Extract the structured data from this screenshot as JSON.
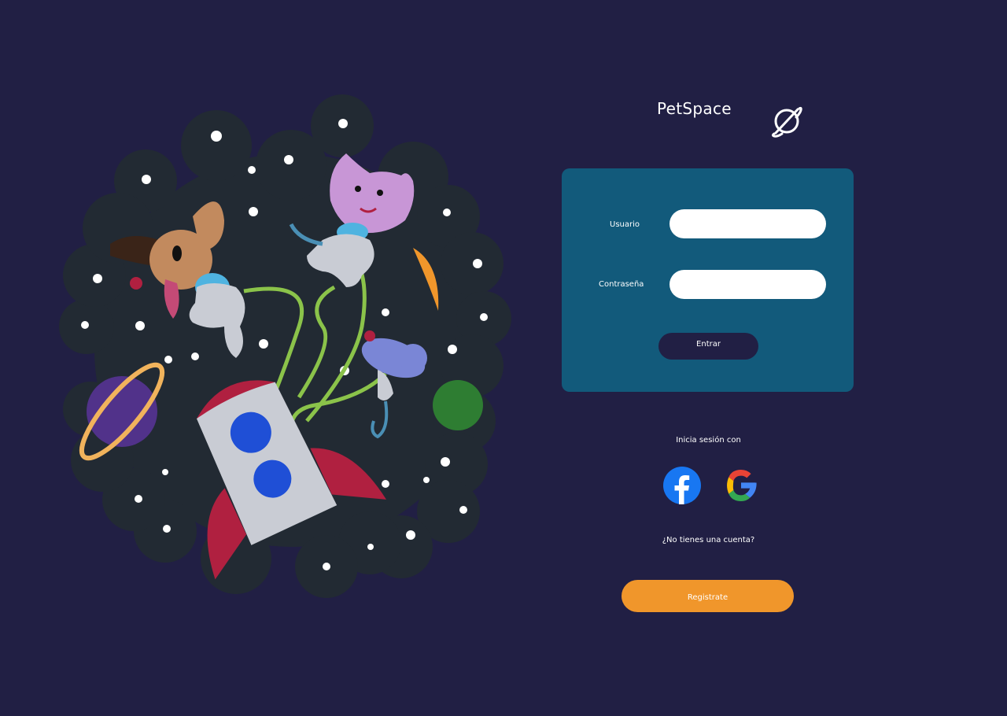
{
  "brand": {
    "name": "PetSpace",
    "logo_icon": "planet-icon"
  },
  "illustration": {
    "description_icon": "space-pets-illustration-icon"
  },
  "login": {
    "username_label": "Usuario",
    "username_value": "",
    "password_label": "Contraseña",
    "password_value": "",
    "submit_label": "Entrar"
  },
  "social": {
    "caption": "Inicia sesión con",
    "providers": [
      {
        "icon": "facebook-icon"
      },
      {
        "icon": "google-icon"
      }
    ]
  },
  "register": {
    "prompt": "¿No tienes una cuenta?",
    "button_label": "Registrate"
  },
  "colors": {
    "background": "#211f44",
    "card": "#125a7b",
    "accent": "#f0962b",
    "button_dark": "#211f44"
  }
}
